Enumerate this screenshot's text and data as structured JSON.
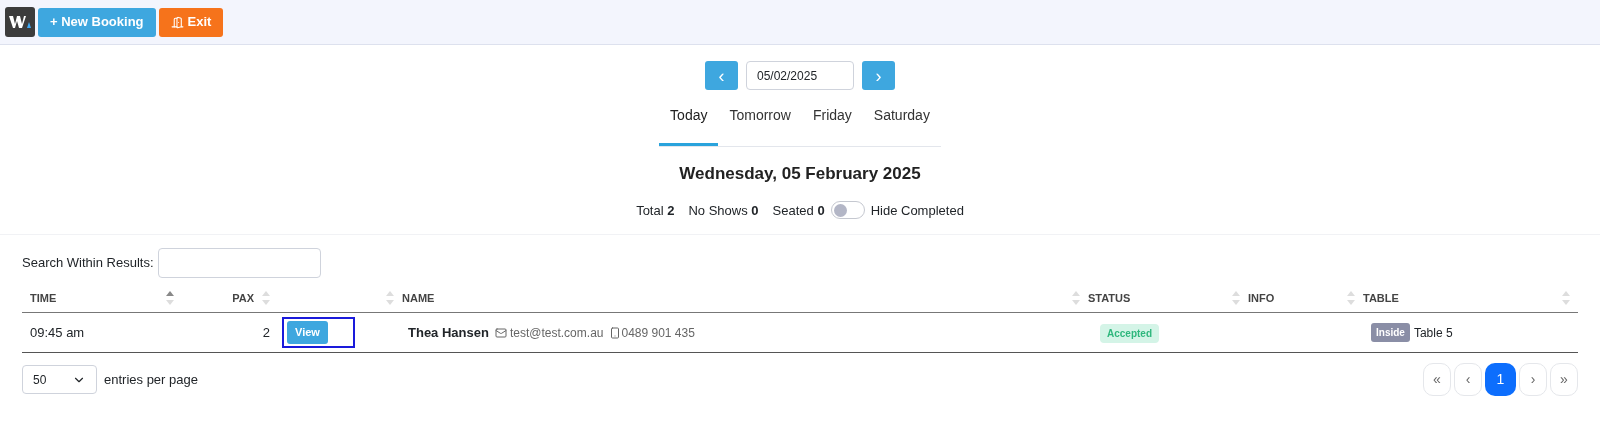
{
  "toolbar": {
    "buttons": [
      {
        "kind": "new",
        "label": "+ New Booking"
      },
      {
        "kind": "exit",
        "label": "Exit"
      }
    ]
  },
  "date_nav": {
    "prev": "‹",
    "date": "05/02/2025",
    "next": "›"
  },
  "tabs": [
    {
      "label": "Today",
      "selected": true
    },
    {
      "label": "Tomorrow",
      "selected": false
    },
    {
      "label": "Friday",
      "selected": false
    },
    {
      "label": "Saturday",
      "selected": false
    }
  ],
  "heading": "Wednesday, 05 February 2025",
  "stats": [
    {
      "label": "Total",
      "value": "2"
    },
    {
      "label": "No Shows",
      "value": "0"
    },
    {
      "label": "Seated",
      "value": "0"
    }
  ],
  "hide_completed": {
    "label": "Hide Completed",
    "on": false
  },
  "search": {
    "label": "Search Within Results:"
  },
  "table": {
    "columns": [
      {
        "label": "TIME",
        "sorted": true
      },
      {
        "label": "PAX",
        "sorted": false
      },
      {
        "sorted": false
      },
      {
        "label": "NAME",
        "sorted": false
      },
      {
        "label": "STATUS",
        "sorted": false
      },
      {
        "label": "INFO",
        "sorted": false
      },
      {
        "label": "TABLE",
        "sorted": false
      }
    ],
    "rows": [
      {
        "time": "09:45 am",
        "pax": "2",
        "action": {
          "label": "View",
          "focused": true
        },
        "name": "Thea Hansen",
        "email": "test@test.com.au",
        "phone": "0489 901 435",
        "status": "Accepted",
        "area": "Inside",
        "table": "Table 5"
      }
    ]
  },
  "page_size": {
    "value": "50",
    "label": "entries per page"
  },
  "pagination": [
    {
      "label": "«",
      "selected": false
    },
    {
      "label": "‹",
      "selected": false
    },
    {
      "label": "1",
      "selected": true
    },
    {
      "label": "›",
      "selected": false
    },
    {
      "label": "»",
      "selected": false
    }
  ]
}
